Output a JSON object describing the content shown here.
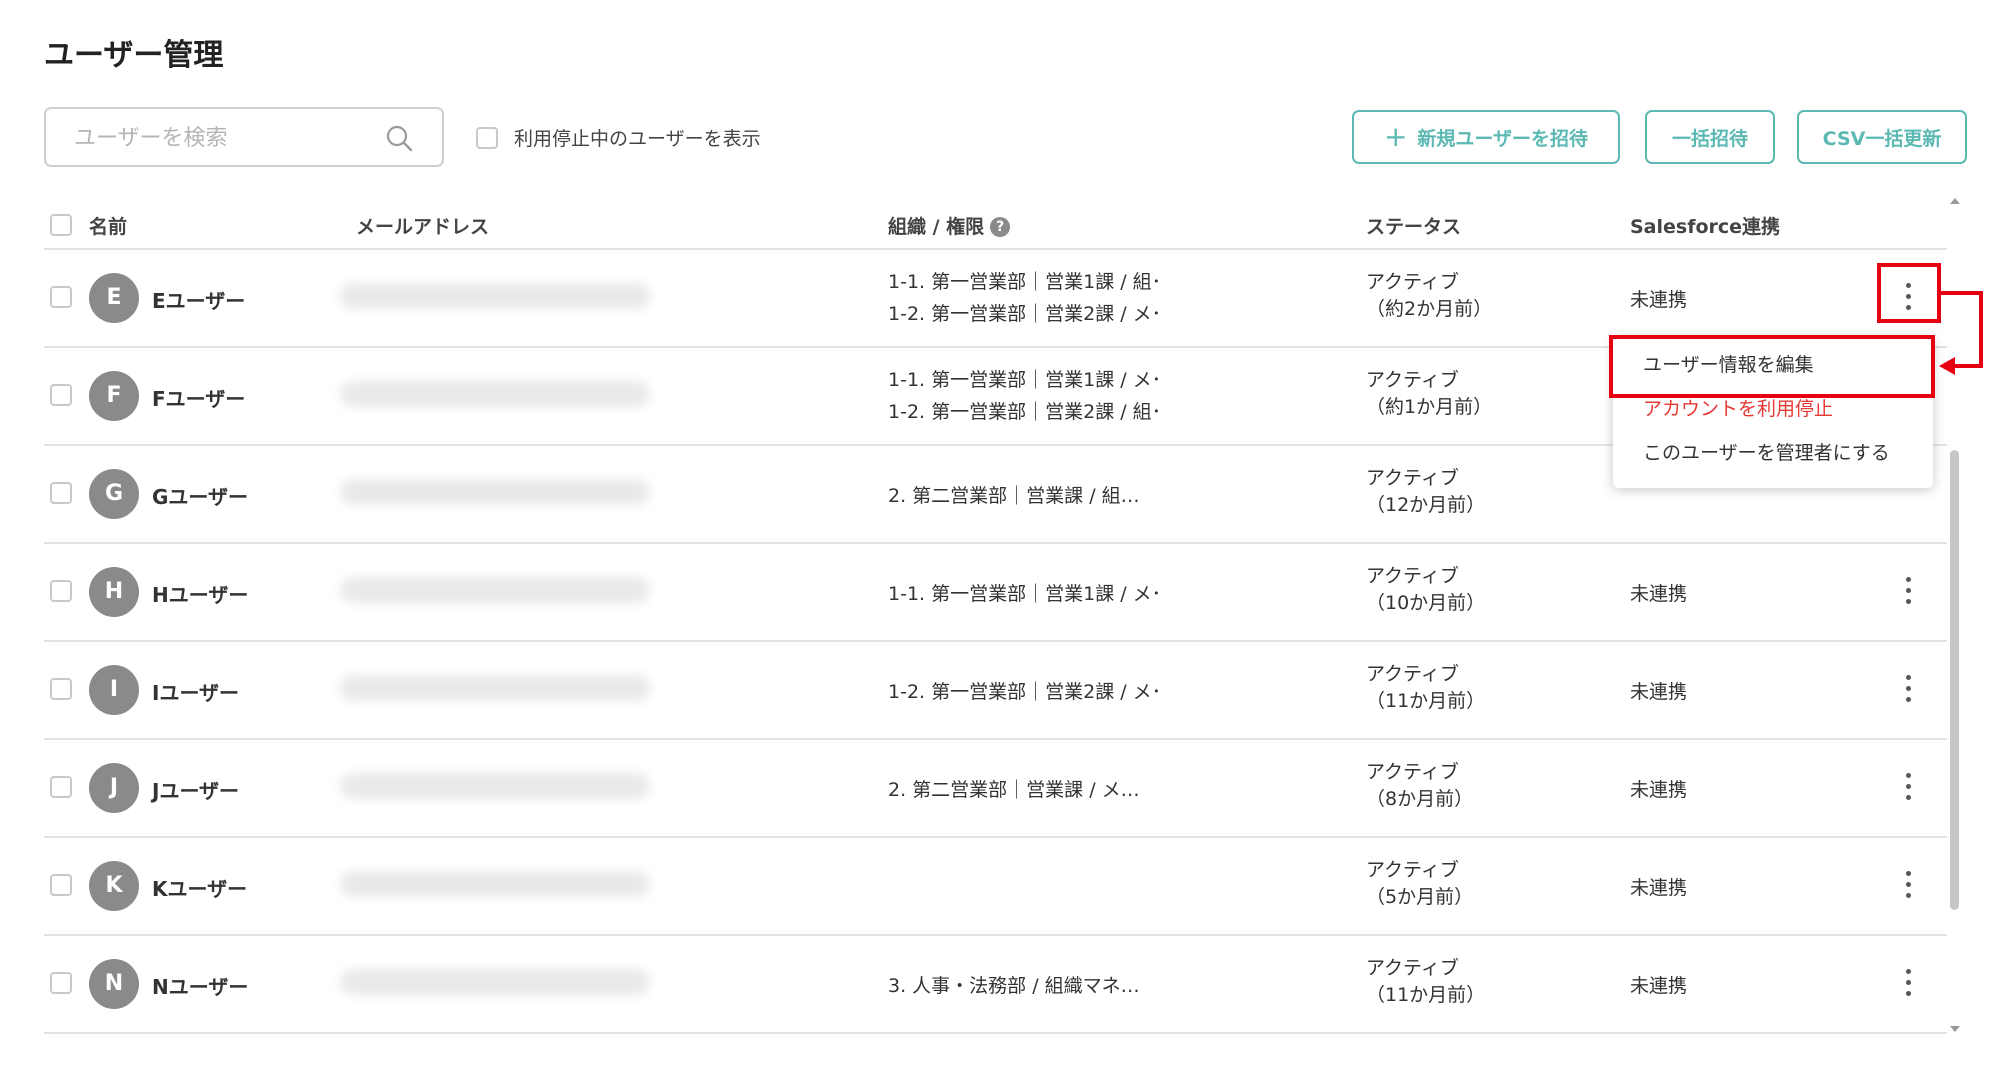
{
  "page": {
    "title": "ユーザー管理"
  },
  "toolbar": {
    "search_placeholder": "ユーザーを検索",
    "show_suspended_label": "利用停止中のユーザーを表示",
    "invite_label": "新規ユーザーを招待",
    "bulk_invite_label": "一括招待",
    "csv_update_label": "CSV一括更新"
  },
  "table": {
    "headers": {
      "name": "名前",
      "email": "メールアドレス",
      "org": "組織 / 権限",
      "status": "ステータス",
      "salesforce": "Salesforce連携"
    },
    "rows": [
      {
        "initial": "E",
        "name": "Eユーザー",
        "org": [
          "1-1. 第一営業部｜営業1課 / 組･",
          "1-2. 第一営業部｜営業2課 / メ･"
        ],
        "status": "アクティブ",
        "since": "（約2か月前）",
        "salesforce": "未連携"
      },
      {
        "initial": "F",
        "name": "Fユーザー",
        "org": [
          "1-1. 第一営業部｜営業1課 / メ･",
          "1-2. 第一営業部｜営業2課 / 組･"
        ],
        "status": "アクティブ",
        "since": "（約1か月前）",
        "salesforce": ""
      },
      {
        "initial": "G",
        "name": "Gユーザー",
        "org": [
          "2. 第二営業部｜営業課 / 組…"
        ],
        "status": "アクティブ",
        "since": "（12か月前）",
        "salesforce": ""
      },
      {
        "initial": "H",
        "name": "Hユーザー",
        "org": [
          "1-1. 第一営業部｜営業1課 / メ･"
        ],
        "status": "アクティブ",
        "since": "（10か月前）",
        "salesforce": "未連携"
      },
      {
        "initial": "I",
        "name": "Iユーザー",
        "org": [
          "1-2. 第一営業部｜営業2課 / メ･"
        ],
        "status": "アクティブ",
        "since": "（11か月前）",
        "salesforce": "未連携"
      },
      {
        "initial": "J",
        "name": "Jユーザー",
        "org": [
          "2. 第二営業部｜営業課 / メ…"
        ],
        "status": "アクティブ",
        "since": "（8か月前）",
        "salesforce": "未連携"
      },
      {
        "initial": "K",
        "name": "Kユーザー",
        "org": [],
        "status": "アクティブ",
        "since": "（5か月前）",
        "salesforce": "未連携"
      },
      {
        "initial": "N",
        "name": "Nユーザー",
        "org": [
          "3. 人事・法務部 / 組織マネ…"
        ],
        "status": "アクティブ",
        "since": "（11か月前）",
        "salesforce": "未連携"
      }
    ]
  },
  "context_menu": {
    "edit": "ユーザー情報を編集",
    "suspend": "アカウントを利用停止",
    "make_admin": "このユーザーを管理者にする"
  },
  "colors": {
    "accent": "#5cb8b2",
    "danger": "#e53935",
    "highlight": "#e60012",
    "avatar": "#8a8a8a"
  }
}
